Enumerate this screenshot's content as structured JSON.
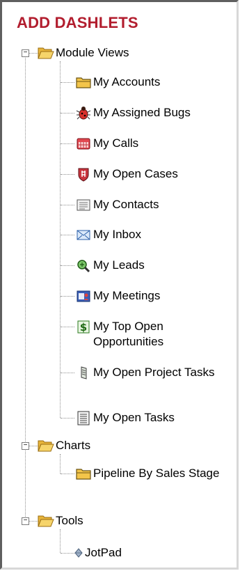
{
  "panel": {
    "title": "ADD DASHLETS"
  },
  "tree": {
    "groups": [
      {
        "label": "Module Views",
        "items": [
          {
            "label": "My Accounts",
            "icon": "folder-closed-icon"
          },
          {
            "label": "My Assigned Bugs",
            "icon": "bug-icon"
          },
          {
            "label": "My Calls",
            "icon": "calendar-icon"
          },
          {
            "label": "My Open Cases",
            "icon": "case-shield-icon"
          },
          {
            "label": "My Contacts",
            "icon": "contacts-card-icon"
          },
          {
            "label": "My Inbox",
            "icon": "envelope-icon"
          },
          {
            "label": "My Leads",
            "icon": "leads-icon"
          },
          {
            "label": "My Meetings",
            "icon": "meetings-icon"
          },
          {
            "label": "My Top Open Opportunities",
            "icon": "dollar-icon"
          },
          {
            "label": "My Open Project Tasks",
            "icon": "project-tasks-icon"
          },
          {
            "label": "My Open Tasks",
            "icon": "tasks-list-icon"
          }
        ]
      },
      {
        "label": "Charts",
        "items": [
          {
            "label": "Pipeline By Sales Stage",
            "icon": "folder-closed-icon"
          }
        ]
      },
      {
        "label": "Tools",
        "items": [
          {
            "label": "JotPad",
            "icon": "jotpad-diamond-icon"
          }
        ]
      }
    ]
  },
  "colors": {
    "title": "#b21d2e",
    "folder": "#f3c54a",
    "tree_lines": "#8f8f8f"
  }
}
